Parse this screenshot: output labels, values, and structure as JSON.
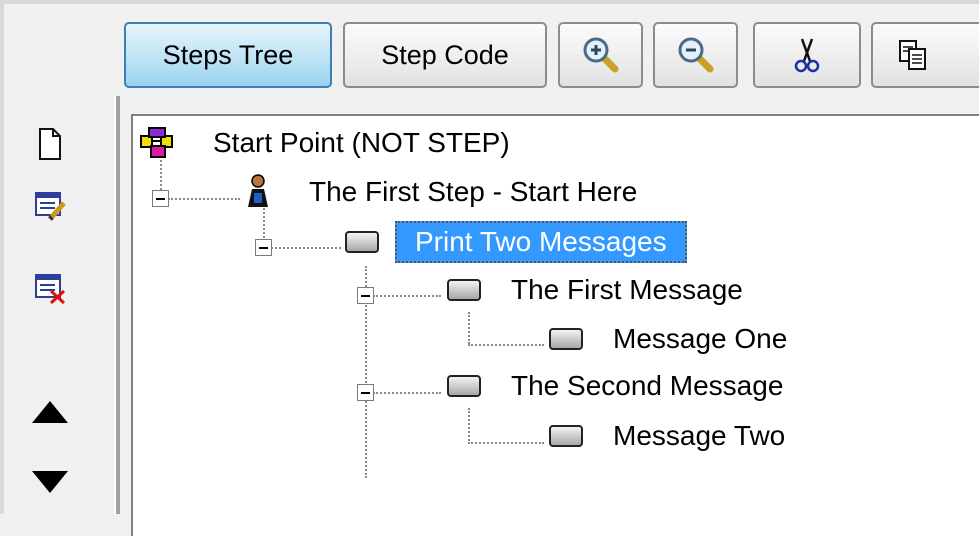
{
  "toolbar": {
    "steps_tree_label": "Steps Tree",
    "step_code_label": "Step Code",
    "zoom_in_icon": "zoom-in-icon",
    "zoom_out_icon": "zoom-out-icon",
    "cut_icon": "cut-icon",
    "copy_icon": "copy-icon"
  },
  "sidebar": {
    "items": [
      {
        "icon": "new-document-icon"
      },
      {
        "icon": "edit-step-icon"
      },
      {
        "icon": "delete-step-icon"
      },
      {
        "icon": "move-up-icon"
      },
      {
        "icon": "move-down-icon"
      }
    ]
  },
  "tree": {
    "root": "Start Point (NOT STEP)",
    "first_step": "The First Step  - Start Here",
    "print_two": "Print Two Messages",
    "first_message": "The First Message",
    "message_one": "Message One",
    "second_message": "The Second Message",
    "message_two": "Message Two"
  },
  "colors": {
    "selection": "#3399ff",
    "active_tab": "#c4e5f6"
  }
}
